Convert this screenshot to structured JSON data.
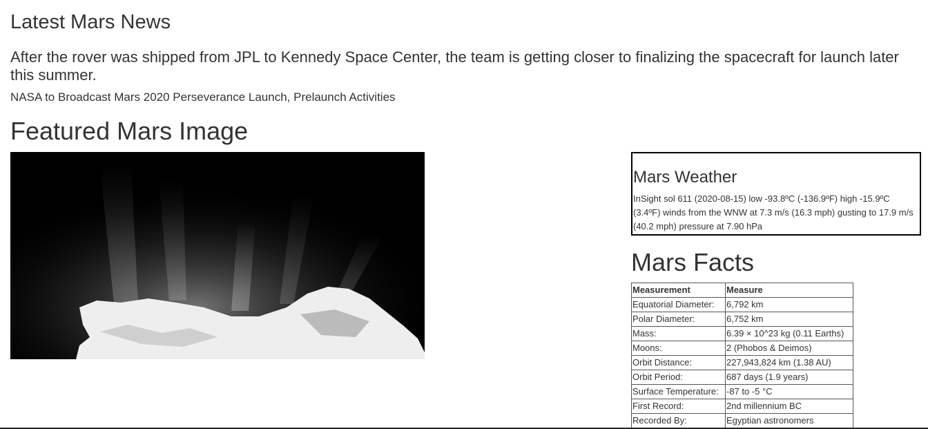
{
  "news": {
    "section_title": "Latest Mars News",
    "teaser": "After the rover was shipped from JPL to Kennedy Space Center, the team is getting closer to finalizing the spacecraft for launch later this summer.",
    "headline": "NASA to Broadcast Mars 2020 Perseverance Launch, Prelaunch Activities"
  },
  "featured": {
    "section_title": "Featured Mars Image"
  },
  "weather": {
    "section_title": "Mars Weather",
    "text": "InSight sol 611 (2020-08-15) low -93.8ºC (-136.9ºF) high -15.9ºC (3.4ºF) winds from the WNW at 7.3 m/s (16.3 mph) gusting to 17.9 m/s (40.2 mph) pressure at 7.90 hPa"
  },
  "facts": {
    "section_title": "Mars Facts",
    "headers": [
      "Measurement",
      "Measure"
    ],
    "rows": [
      [
        "Equatorial Diameter:",
        "6,792 km"
      ],
      [
        "Polar Diameter:",
        "6,752 km"
      ],
      [
        "Mass:",
        "6.39 × 10^23 kg (0.11 Earths)"
      ],
      [
        "Moons:",
        "2 (Phobos & Deimos)"
      ],
      [
        "Orbit Distance:",
        "227,943,824 km (1.38 AU)"
      ],
      [
        "Orbit Period:",
        "687 days (1.9 years)"
      ],
      [
        "Surface Temperature:",
        "-87 to -5 °C"
      ],
      [
        "First Record:",
        "2nd millennium BC"
      ],
      [
        "Recorded By:",
        "Egyptian astronomers"
      ]
    ]
  }
}
